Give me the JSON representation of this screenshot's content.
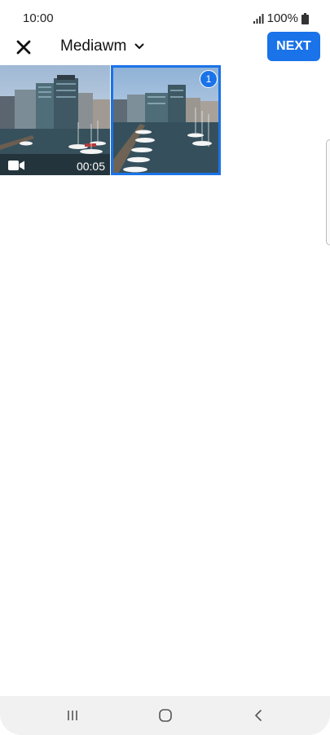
{
  "status_bar": {
    "time": "10:00",
    "battery": "100%",
    "icons": [
      "signal-icon",
      "battery-icon"
    ]
  },
  "toolbar": {
    "close_icon": "close-icon",
    "album_title": "Mediawm",
    "dropdown_icon": "chevron-down-icon",
    "next_label": "NEXT"
  },
  "media": {
    "items": [
      {
        "type": "video",
        "duration": "00:05",
        "icon": "video-camera-icon",
        "selected": false
      },
      {
        "type": "image",
        "selection_number": "1",
        "selected": true
      }
    ]
  },
  "navigation": {
    "icons": [
      "recents-icon",
      "home-icon",
      "back-icon"
    ]
  },
  "colors": {
    "accent": "#1a73e8",
    "background": "#ffffff",
    "nav_bar": "#f1f1f1"
  }
}
